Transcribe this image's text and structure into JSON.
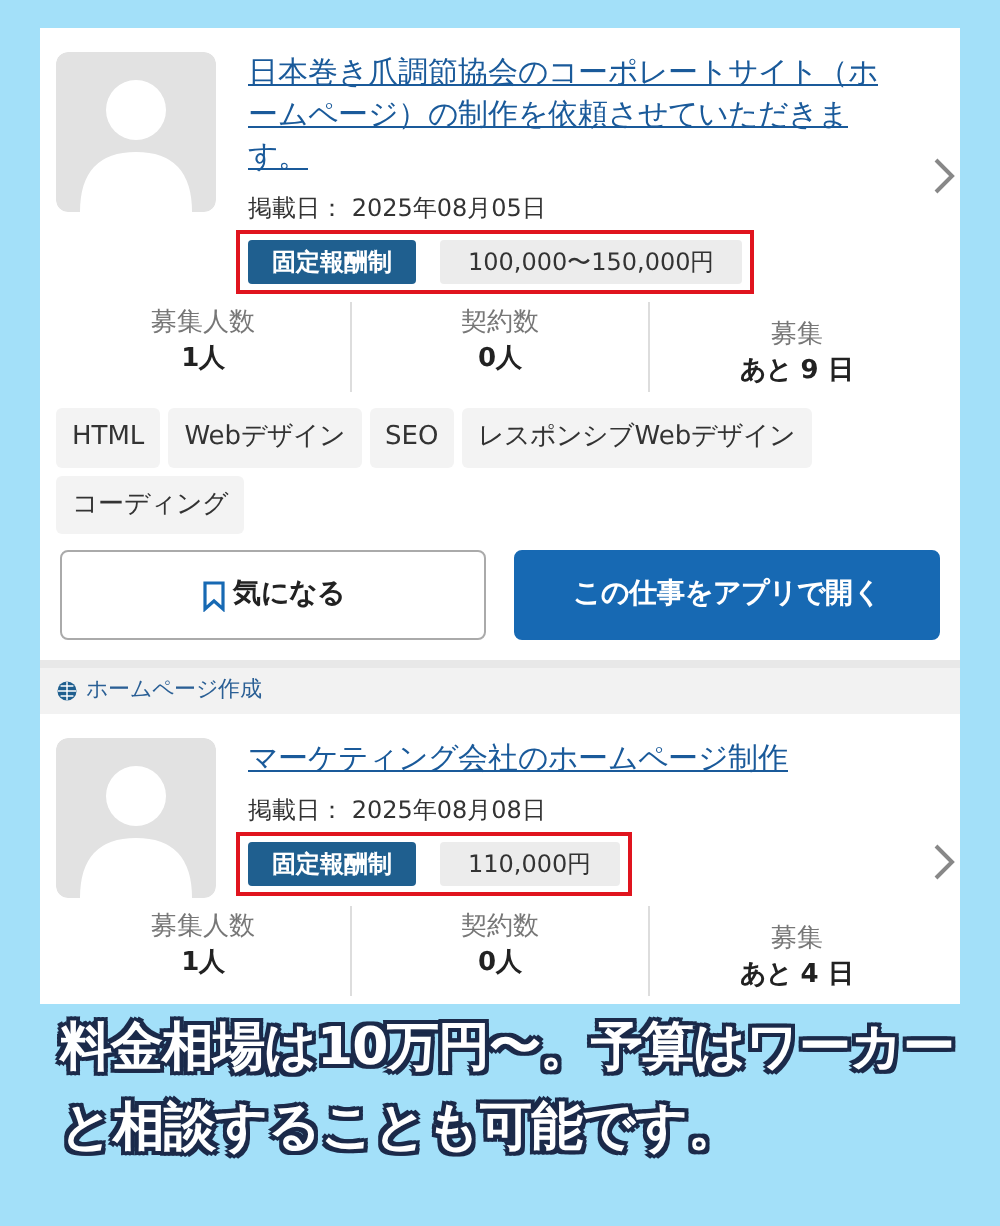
{
  "jobs": [
    {
      "title": "日本巻き爪調節協会のコーポレートサイト（ホームページ）の制作を依頼させていただきます。",
      "posted_label": "掲載日：",
      "posted_date": "2025年08月05日",
      "pay_type": "固定報酬制",
      "pay_amount": "100,000〜150,000円",
      "highlighted": true,
      "stats": [
        {
          "label": "募集人数",
          "value": "1人"
        },
        {
          "label": "契約数",
          "value": "0人"
        },
        {
          "label": "募集",
          "value": "あと 9 日"
        }
      ],
      "tags": [
        "HTML",
        "Webデザイン",
        "SEO",
        "レスポンシブWebデザイン",
        "コーディング"
      ],
      "buttons": [
        {
          "kind": "outline",
          "label": "気になる"
        },
        {
          "kind": "primary",
          "label": "この仕事をアプリで開く"
        }
      ]
    },
    {
      "category": "ホームページ作成",
      "title": "マーケティング会社のホームページ制作",
      "posted_label": "掲載日：",
      "posted_date": "2025年08月08日",
      "pay_type": "固定報酬制",
      "pay_amount": "110,000円",
      "highlighted": true,
      "stats": [
        {
          "label": "募集人数",
          "value": "1人"
        },
        {
          "label": "契約数",
          "value": "0人"
        },
        {
          "label": "募集",
          "value": "あと 4 日"
        }
      ]
    }
  ],
  "caption": "料金相場は10万円〜。予算はワーカーと相談することも可能です。"
}
